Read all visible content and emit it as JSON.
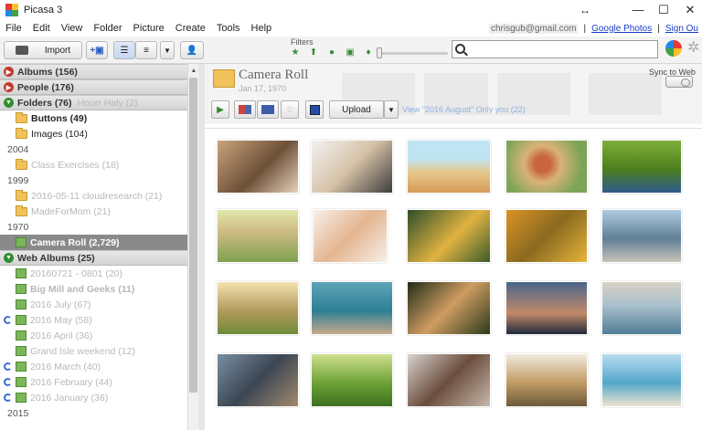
{
  "window": {
    "title": "Picasa 3",
    "minimize": "—",
    "maximize": "☐",
    "close": "✕",
    "resize_glyph": "↔"
  },
  "menu": {
    "items": [
      "File",
      "Edit",
      "View",
      "Folder",
      "Picture",
      "Create",
      "Tools",
      "Help"
    ],
    "account": "chrisgub@gmail.com",
    "sep": "|",
    "google_photos": "Google Photos",
    "sign_out": "Sign Ou"
  },
  "toolbar": {
    "import": "Import",
    "filters": "Filters",
    "search_placeholder": ""
  },
  "sidebar": {
    "albums": "Albums (156)",
    "people": "People (176)",
    "folders": "Folders (76)",
    "folders_ghost": "Hoorr Haly (2)",
    "items": [
      {
        "label": "Buttons (49)"
      },
      {
        "label": "Images (104)"
      },
      {
        "label": "2004"
      },
      {
        "label": "Class Exercises (18)"
      },
      {
        "label": "1999"
      },
      {
        "label": "2016-05-11 cloudresearch (21)"
      },
      {
        "label": "MadeForMom (21)"
      },
      {
        "label": "1970"
      },
      {
        "label": "Camera Roll (2,729)"
      },
      {
        "label": "Web Albums (25)"
      },
      {
        "label": "20160721 - 0801 (20)"
      },
      {
        "label": "Big Mill and Geeks (11)"
      },
      {
        "label": "2016 July (67)"
      },
      {
        "label": "2016 May (58)"
      },
      {
        "label": "2016 April (36)"
      },
      {
        "label": "Grand Isle weekend (12)"
      },
      {
        "label": "2016 March (40)"
      },
      {
        "label": "2016 February (44)"
      },
      {
        "label": "2016 January (36)"
      },
      {
        "label": "2015"
      }
    ]
  },
  "album": {
    "title": "Camera Roll",
    "date": "Jan 17, 1970",
    "sync_label": "Sync to Web",
    "upload": "Upload",
    "share_link": "View \"2016 August\" Only you (22)"
  },
  "photos": [
    {
      "name": "family-sofa"
    },
    {
      "name": "couple-kids"
    },
    {
      "name": "beach-family"
    },
    {
      "name": "girl-hat"
    },
    {
      "name": "park-lake"
    },
    {
      "name": "family-field"
    },
    {
      "name": "baby-kiss"
    },
    {
      "name": "woman-scarf"
    },
    {
      "name": "autumn-park"
    },
    {
      "name": "coast-rocks"
    },
    {
      "name": "family-walk"
    },
    {
      "name": "father-son-sea"
    },
    {
      "name": "girl-lying"
    },
    {
      "name": "city-sunset"
    },
    {
      "name": "couple-beach"
    },
    {
      "name": "train-station"
    },
    {
      "name": "grass-girl"
    },
    {
      "name": "friends-guitar"
    },
    {
      "name": "desert-woman"
    },
    {
      "name": "beach-sit"
    }
  ]
}
